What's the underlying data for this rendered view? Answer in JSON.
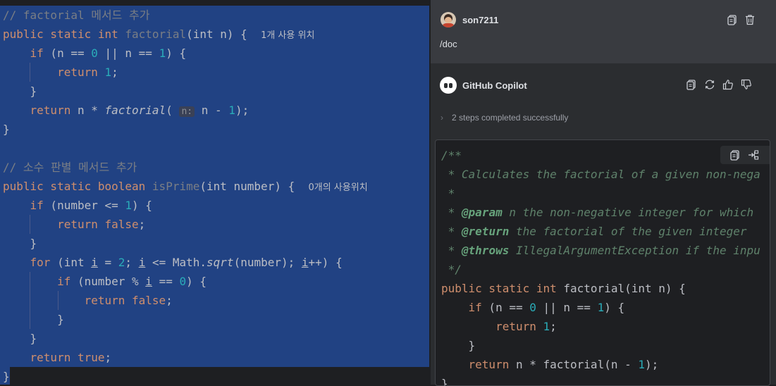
{
  "editor": {
    "lines": [
      {
        "comment": "// factorial 메서드 추가"
      },
      {
        "kw": "public static int ",
        "name": "factorial",
        "rest": "(int n) {  ",
        "hint": "1개 사용 위치"
      },
      {
        "indent": "    ",
        "kw": "if",
        "pre": " (n == ",
        "n1": "0",
        "mid": " || n == ",
        "n2": "1",
        "post": ") {"
      },
      {
        "indent": "        ",
        "kw": "return ",
        "n1": "1",
        "post": ";"
      },
      {
        "indent": "    ",
        "text": "}"
      },
      {
        "indent": "    ",
        "kw": "return ",
        "pre": "n * ",
        "call": "factorial",
        "open": "( ",
        "inlay": "n:",
        "post": " n - ",
        "n1": "1",
        "end": ");"
      },
      {
        "text": "}"
      },
      {
        "text": ""
      },
      {
        "comment": "// 소수 판별 메서드 추가"
      },
      {
        "kw": "public static boolean ",
        "name": "isPrime",
        "rest": "(int number) {  ",
        "hint": "0개의 사용위치"
      },
      {
        "indent": "    ",
        "kw": "if",
        "pre": " (number <= ",
        "n1": "1",
        "post": ") {"
      },
      {
        "indent": "        ",
        "kw": "return false",
        "post": ";"
      },
      {
        "indent": "    ",
        "text": "}"
      },
      {
        "indent": "    ",
        "kw": "for",
        "pre": " (int ",
        "u1": "i",
        "p2": " = ",
        "n1": "2",
        "p3": "; ",
        "u2": "i",
        "p4": " <= Math.",
        "call": "sqrt",
        "p5": "(number); ",
        "u3": "i",
        "p6": "++) {"
      },
      {
        "indent": "        ",
        "kw": "if",
        "pre": " (number % ",
        "u1": "i",
        "mid": " == ",
        "n1": "0",
        "post": ") {"
      },
      {
        "indent": "            ",
        "kw": "return false",
        "post": ";"
      },
      {
        "indent": "        ",
        "text": "}"
      },
      {
        "indent": "    ",
        "text": "}"
      },
      {
        "indent": "    ",
        "kw": "return true",
        "post": ";"
      },
      {
        "text": "}"
      }
    ]
  },
  "chat": {
    "user": {
      "name": "son7211",
      "message": "/doc"
    },
    "assistant": {
      "name": "GitHub Copilot",
      "status": "2 steps completed successfully"
    },
    "code": {
      "doc_open": "/**",
      "doc_line1": " * Calculates the factorial of a given non-nega",
      "doc_blank": " *",
      "param_tag": "@param",
      "param_text": " n the non-negative integer for which",
      "return_tag": "@return",
      "return_text": " the factorial of the given integer",
      "throws_tag": "@throws",
      "throws_text": " IllegalArgumentException if the inpu",
      "doc_close": " */",
      "sig_kw": "public static int ",
      "sig_rest": "factorial(int n) {",
      "if_kw": "if",
      "if_pre": " (n == ",
      "if_n1": "0",
      "if_mid": " || n == ",
      "if_n2": "1",
      "if_post": ") {",
      "ret_kw": "return ",
      "ret_n": "1",
      "ret_post": ";",
      "close_brace": "}",
      "ret2_kw": "return ",
      "ret2_rest": "n * factorial(n - ",
      "ret2_n": "1",
      "ret2_end": ");",
      "last_brace": "}"
    }
  },
  "colors": {
    "selection": "#214283",
    "keyword": "#cf8e6d",
    "number": "#2aacb8",
    "doc": "#5f826b"
  },
  "icons": [
    "copy-icon",
    "delete-icon",
    "regenerate-icon",
    "thumbs-up-icon",
    "thumbs-down-icon",
    "insert-icon",
    "chevron-right-icon"
  ]
}
